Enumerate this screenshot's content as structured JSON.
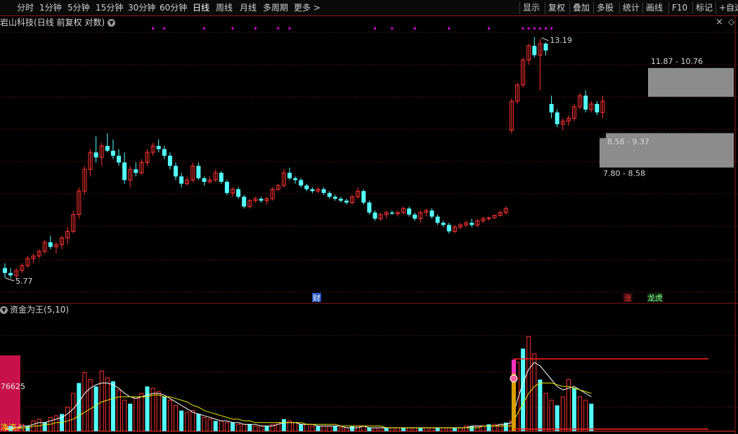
{
  "toolbar": {
    "periods": [
      "分时",
      "1分钟",
      "5分钟",
      "15分钟",
      "30分钟",
      "60分钟",
      "日线",
      "周线",
      "月线",
      "多周期",
      "更多"
    ],
    "active_period": "日线",
    "more_arrow": ">",
    "right_buttons": [
      "显示",
      "复权",
      "叠加",
      "多股",
      "统计",
      "画线",
      "F10",
      "标记",
      "+自选"
    ]
  },
  "stock": {
    "name": "岩山科技",
    "mode": "(日线 前复权 对数)",
    "chevron_icon": "chevron-down-icon"
  },
  "window_icons": {
    "close": "×",
    "diamond": "◇"
  },
  "price_labels": {
    "high_marker": "13.19",
    "low_marker": "5.77",
    "zone_top": "11.87 - 10.76",
    "zone_mid": "8.58 - 9.37",
    "zone_low": "7.80 - 8.58"
  },
  "event_tags": {
    "cai": "财",
    "zhang": "涨",
    "longhu": "龙虎"
  },
  "indicator": {
    "name": "资金为王(5,10)",
    "value_label": "76625",
    "net_inflow_label": "净流入"
  },
  "colors": {
    "up": "#ff3232",
    "down": "#54ffff",
    "grid": "#8b1a1a",
    "zone": "#8c8c8c",
    "marker": "#d000d0",
    "ma_white": "#ffffff",
    "ma_yellow": "#e8e800",
    "net_inflow_bar": "#c8104a",
    "tag_cai": "#2050c0",
    "tag_zhang": "#a01818",
    "tag_longhu": "#208040"
  },
  "chart_data": {
    "type": "candlestick",
    "ylim": [
      5.5,
      13.6
    ],
    "log_scale": true,
    "candles": [
      [
        6.0,
        6.1,
        5.8,
        5.9
      ],
      [
        5.9,
        6.0,
        5.8,
        5.85
      ],
      [
        5.85,
        6.0,
        5.77,
        5.95
      ],
      [
        5.95,
        6.1,
        5.9,
        6.05
      ],
      [
        6.05,
        6.25,
        6.0,
        6.2
      ],
      [
        6.2,
        6.3,
        6.1,
        6.25
      ],
      [
        6.25,
        6.4,
        6.2,
        6.35
      ],
      [
        6.35,
        6.6,
        6.3,
        6.55
      ],
      [
        6.55,
        6.7,
        6.4,
        6.45
      ],
      [
        6.45,
        6.55,
        6.3,
        6.5
      ],
      [
        6.5,
        6.7,
        6.4,
        6.65
      ],
      [
        6.65,
        6.9,
        6.5,
        6.8
      ],
      [
        6.8,
        7.3,
        6.75,
        7.2
      ],
      [
        7.2,
        7.9,
        7.1,
        7.8
      ],
      [
        7.8,
        8.5,
        7.7,
        8.4
      ],
      [
        8.4,
        9.0,
        8.2,
        8.9
      ],
      [
        8.9,
        9.4,
        8.6,
        8.75
      ],
      [
        8.75,
        9.2,
        8.5,
        9.1
      ],
      [
        9.1,
        9.5,
        8.9,
        8.95
      ],
      [
        8.95,
        9.3,
        8.7,
        8.8
      ],
      [
        8.8,
        9.0,
        8.5,
        8.6
      ],
      [
        8.6,
        8.9,
        8.0,
        8.1
      ],
      [
        8.1,
        8.5,
        7.9,
        8.4
      ],
      [
        8.4,
        8.6,
        8.2,
        8.3
      ],
      [
        8.3,
        8.7,
        8.25,
        8.6
      ],
      [
        8.6,
        9.0,
        8.5,
        8.9
      ],
      [
        8.9,
        9.2,
        8.8,
        9.1
      ],
      [
        9.1,
        9.3,
        8.9,
        9.0
      ],
      [
        9.0,
        9.1,
        8.7,
        8.8
      ],
      [
        8.8,
        8.9,
        8.4,
        8.5
      ],
      [
        8.5,
        8.6,
        8.1,
        8.2
      ],
      [
        8.2,
        8.3,
        7.9,
        8.0
      ],
      [
        8.0,
        8.2,
        7.95,
        8.1
      ],
      [
        8.1,
        8.6,
        8.05,
        8.5
      ],
      [
        8.5,
        8.6,
        8.1,
        8.15
      ],
      [
        8.15,
        8.2,
        7.95,
        8.05
      ],
      [
        8.05,
        8.2,
        8.0,
        8.1
      ],
      [
        8.1,
        8.4,
        8.05,
        8.3
      ],
      [
        8.3,
        8.35,
        8.0,
        8.05
      ],
      [
        8.05,
        8.1,
        7.7,
        7.75
      ],
      [
        7.75,
        7.9,
        7.65,
        7.85
      ],
      [
        7.85,
        7.9,
        7.6,
        7.65
      ],
      [
        7.65,
        7.7,
        7.35,
        7.4
      ],
      [
        7.4,
        7.6,
        7.35,
        7.55
      ],
      [
        7.55,
        7.65,
        7.5,
        7.6
      ],
      [
        7.6,
        7.65,
        7.5,
        7.55
      ],
      [
        7.55,
        7.65,
        7.45,
        7.6
      ],
      [
        7.6,
        7.9,
        7.55,
        7.85
      ],
      [
        7.85,
        8.0,
        7.8,
        7.95
      ],
      [
        7.95,
        8.4,
        7.9,
        8.3
      ],
      [
        8.3,
        8.45,
        8.1,
        8.15
      ],
      [
        8.15,
        8.2,
        8.0,
        8.1
      ],
      [
        8.1,
        8.15,
        7.9,
        7.95
      ],
      [
        7.95,
        8.0,
        7.8,
        7.85
      ],
      [
        7.85,
        7.9,
        7.75,
        7.8
      ],
      [
        7.8,
        7.9,
        7.75,
        7.85
      ],
      [
        7.85,
        7.9,
        7.7,
        7.75
      ],
      [
        7.75,
        7.8,
        7.6,
        7.65
      ],
      [
        7.65,
        7.7,
        7.55,
        7.6
      ],
      [
        7.6,
        7.65,
        7.5,
        7.55
      ],
      [
        7.55,
        7.6,
        7.45,
        7.5
      ],
      [
        7.5,
        7.7,
        7.45,
        7.65
      ],
      [
        7.65,
        7.9,
        7.6,
        7.8
      ],
      [
        7.8,
        7.85,
        7.45,
        7.5
      ],
      [
        7.5,
        7.55,
        7.2,
        7.25
      ],
      [
        7.25,
        7.3,
        7.05,
        7.1
      ],
      [
        7.1,
        7.25,
        7.05,
        7.2
      ],
      [
        7.2,
        7.3,
        7.1,
        7.25
      ],
      [
        7.25,
        7.3,
        7.2,
        7.22
      ],
      [
        7.22,
        7.3,
        7.15,
        7.25
      ],
      [
        7.25,
        7.4,
        7.2,
        7.35
      ],
      [
        7.35,
        7.4,
        7.15,
        7.2
      ],
      [
        7.2,
        7.25,
        7.05,
        7.1
      ],
      [
        7.1,
        7.3,
        7.0,
        7.25
      ],
      [
        7.25,
        7.35,
        7.15,
        7.3
      ],
      [
        7.3,
        7.35,
        7.1,
        7.15
      ],
      [
        7.15,
        7.2,
        6.95,
        7.0
      ],
      [
        7.0,
        7.05,
        6.9,
        6.95
      ],
      [
        6.95,
        7.0,
        6.75,
        6.8
      ],
      [
        6.8,
        6.95,
        6.75,
        6.9
      ],
      [
        6.9,
        7.0,
        6.85,
        6.95
      ],
      [
        6.95,
        7.05,
        6.9,
        7.0
      ],
      [
        7.0,
        7.1,
        6.9,
        6.95
      ],
      [
        6.95,
        7.1,
        6.9,
        7.05
      ],
      [
        7.05,
        7.15,
        7.0,
        7.1
      ],
      [
        7.1,
        7.15,
        7.05,
        7.12
      ],
      [
        7.12,
        7.2,
        7.1,
        7.18
      ],
      [
        7.18,
        7.3,
        7.15,
        7.25
      ],
      [
        7.25,
        7.4,
        7.2,
        7.35
      ],
      [
        9.6,
        10.7,
        9.5,
        10.6
      ],
      [
        10.6,
        11.3,
        10.5,
        11.2
      ],
      [
        11.2,
        12.3,
        11.1,
        12.2
      ],
      [
        12.2,
        12.9,
        12.0,
        12.8
      ],
      [
        12.8,
        13.19,
        12.3,
        12.4
      ],
      [
        12.4,
        13.1,
        11.0,
        12.9
      ],
      [
        12.9,
        12.95,
        12.4,
        12.6
      ],
      [
        10.5,
        10.8,
        10.0,
        10.2
      ],
      [
        10.2,
        10.3,
        9.7,
        9.8
      ],
      [
        9.8,
        10.0,
        9.6,
        9.9
      ],
      [
        9.9,
        10.1,
        9.75,
        10.0
      ],
      [
        10.0,
        10.5,
        9.9,
        10.4
      ],
      [
        10.4,
        10.9,
        10.3,
        10.8
      ],
      [
        10.8,
        11.0,
        10.2,
        10.3
      ],
      [
        10.3,
        10.6,
        10.2,
        10.5
      ],
      [
        10.5,
        10.6,
        10.1,
        10.2
      ],
      [
        10.2,
        10.8,
        10.0,
        10.6
      ]
    ],
    "purple_markers_at": [
      26,
      28,
      35,
      40,
      44,
      48,
      50,
      65,
      68,
      72,
      78,
      85,
      91,
      92,
      93,
      94,
      95,
      96
    ],
    "indicator": {
      "bars": [
        2,
        3,
        2,
        4,
        3,
        6,
        7,
        5,
        8,
        9,
        10,
        14,
        22,
        28,
        34,
        30,
        26,
        35,
        31,
        29,
        24,
        18,
        16,
        20,
        22,
        26,
        25,
        23,
        20,
        18,
        15,
        12,
        11,
        12,
        10,
        8,
        7,
        6,
        6,
        5,
        5,
        4,
        4,
        4,
        3,
        3,
        3,
        4,
        5,
        7,
        6,
        5,
        4,
        4,
        3,
        3,
        3,
        3,
        3,
        2,
        2,
        3,
        3,
        3,
        2,
        2,
        2,
        2,
        2,
        2,
        2,
        2,
        2,
        2,
        2,
        2,
        2,
        2,
        2,
        2,
        2,
        3,
        3,
        3,
        3,
        4,
        4,
        4,
        5,
        6,
        40,
        48,
        55,
        45,
        30,
        22,
        18,
        15,
        20,
        30,
        25,
        20,
        18,
        16
      ],
      "line_white": [
        1,
        2,
        2,
        3,
        3,
        4,
        5,
        5,
        6,
        7,
        8,
        10,
        13,
        17,
        22,
        25,
        27,
        28,
        28,
        27,
        25,
        22,
        20,
        19,
        20,
        21,
        22,
        22,
        21,
        19,
        17,
        15,
        13,
        11,
        10,
        9,
        8,
        7,
        6,
        6,
        5,
        5,
        4,
        4,
        4,
        3,
        3,
        3,
        4,
        5,
        5,
        5,
        4,
        4,
        4,
        3,
        3,
        3,
        3,
        3,
        2,
        2,
        2,
        3,
        2,
        2,
        2,
        2,
        2,
        2,
        2,
        2,
        2,
        2,
        2,
        2,
        2,
        2,
        2,
        2,
        2,
        2,
        3,
        3,
        3,
        3,
        3,
        4,
        4,
        5,
        18,
        28,
        36,
        40,
        38,
        34,
        30,
        26,
        24,
        25,
        26,
        24,
        22,
        20
      ],
      "line_yellow": [
        1,
        1,
        2,
        2,
        2,
        3,
        3,
        4,
        4,
        5,
        5,
        6,
        7,
        9,
        11,
        13,
        15,
        17,
        18,
        19,
        20,
        20,
        20,
        20,
        20,
        20,
        21,
        21,
        20,
        20,
        19,
        18,
        17,
        15,
        14,
        12,
        11,
        10,
        9,
        8,
        7,
        7,
        6,
        6,
        5,
        5,
        5,
        5,
        5,
        5,
        5,
        5,
        5,
        4,
        4,
        4,
        4,
        4,
        4,
        3,
        3,
        3,
        3,
        3,
        3,
        3,
        3,
        2,
        2,
        2,
        2,
        2,
        2,
        2,
        2,
        2,
        2,
        2,
        2,
        2,
        2,
        2,
        2,
        2,
        3,
        3,
        3,
        3,
        3,
        3,
        10,
        16,
        22,
        26,
        28,
        28,
        28,
        27,
        26,
        26,
        25,
        24,
        23,
        22
      ]
    }
  }
}
